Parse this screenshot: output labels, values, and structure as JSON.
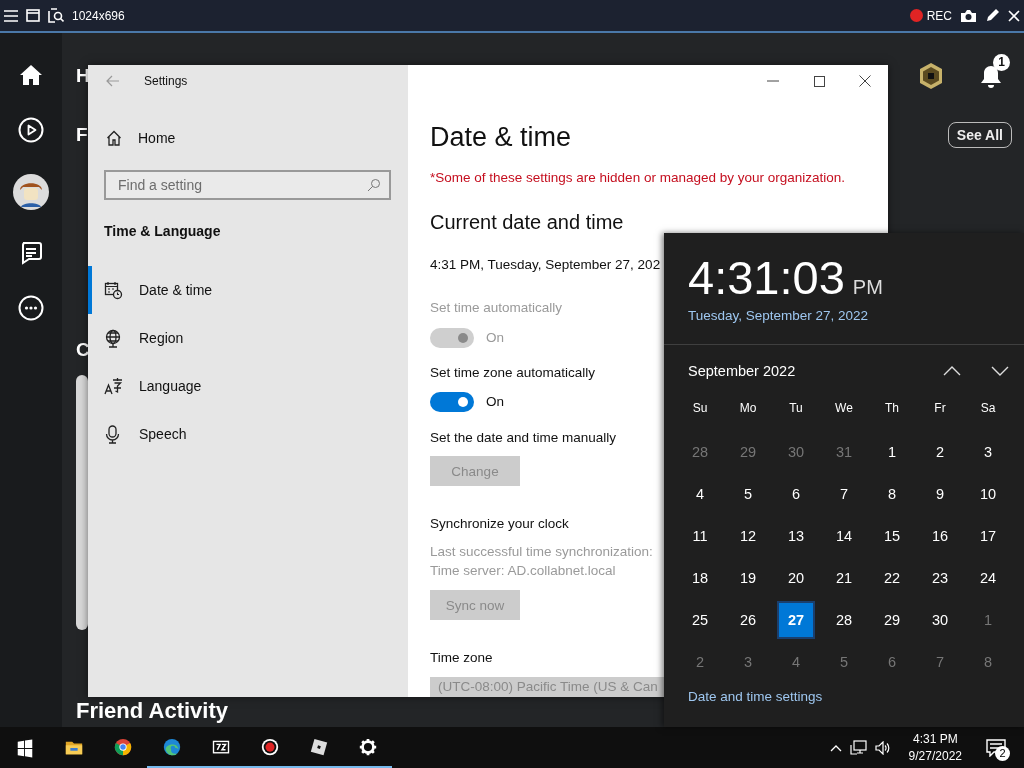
{
  "recorder_bar": {
    "resolution": "1024x696",
    "rec_label": "REC",
    "recording": true
  },
  "app": {
    "rail": [
      {
        "kind": "home"
      },
      {
        "kind": "play"
      },
      {
        "kind": "avatar"
      },
      {
        "kind": "chat"
      },
      {
        "kind": "more"
      }
    ],
    "heading_1": "H",
    "heading_2": "F",
    "heading_3": "C",
    "see_all": "See All",
    "notification_count": "1",
    "friend_activity": "Friend Activity"
  },
  "settings": {
    "title": "Settings",
    "home": "Home",
    "search_placeholder": "Find a setting",
    "section": "Time & Language",
    "nav": [
      {
        "label": "Date & time",
        "kind": "calendar",
        "selected": true
      },
      {
        "label": "Region",
        "kind": "globe",
        "selected": false
      },
      {
        "label": "Language",
        "kind": "language",
        "selected": false
      },
      {
        "label": "Speech",
        "kind": "microphone",
        "selected": false
      }
    ],
    "page_title": "Date & time",
    "notice": "*Some of these settings are hidden or managed by your organization.",
    "current_heading": "Current date and time",
    "current_value": "4:31 PM, Tuesday, September 27, 202",
    "toggles": [
      {
        "label": "Set time automatically",
        "state_label": "On",
        "on": true,
        "disabled": true
      },
      {
        "label": "Set time zone automatically",
        "state_label": "On",
        "on": true,
        "disabled": false
      }
    ],
    "manual_label": "Set the date and time manually",
    "change_button": {
      "label": "Change",
      "disabled": true
    },
    "sync_heading": "Synchronize your clock",
    "sync_lines": [
      "Last successful time synchronization:",
      "Time server: AD.collabnet.local"
    ],
    "sync_button": {
      "label": "Sync now",
      "disabled": true
    },
    "timezone_label": "Time zone",
    "timezone_value": "(UTC-08:00) Pacific Time (US & Can",
    "timezone_disabled": true
  },
  "clock_flyout": {
    "time": "4:31:03",
    "ampm": "PM",
    "date": "Tuesday, September 27, 2022",
    "month": "September 2022",
    "weekdays": [
      "Su",
      "Mo",
      "Tu",
      "We",
      "Th",
      "Fr",
      "Sa"
    ],
    "weeks": [
      [
        {
          "day": "28",
          "in_month": false,
          "selected": false
        },
        {
          "day": "29",
          "in_month": false,
          "selected": false
        },
        {
          "day": "30",
          "in_month": false,
          "selected": false
        },
        {
          "day": "31",
          "in_month": false,
          "selected": false
        },
        {
          "day": "1",
          "in_month": true,
          "selected": false
        },
        {
          "day": "2",
          "in_month": true,
          "selected": false
        },
        {
          "day": "3",
          "in_month": true,
          "selected": false
        }
      ],
      [
        {
          "day": "4",
          "in_month": true,
          "selected": false
        },
        {
          "day": "5",
          "in_month": true,
          "selected": false
        },
        {
          "day": "6",
          "in_month": true,
          "selected": false
        },
        {
          "day": "7",
          "in_month": true,
          "selected": false
        },
        {
          "day": "8",
          "in_month": true,
          "selected": false
        },
        {
          "day": "9",
          "in_month": true,
          "selected": false
        },
        {
          "day": "10",
          "in_month": true,
          "selected": false
        }
      ],
      [
        {
          "day": "11",
          "in_month": true,
          "selected": false
        },
        {
          "day": "12",
          "in_month": true,
          "selected": false
        },
        {
          "day": "13",
          "in_month": true,
          "selected": false
        },
        {
          "day": "14",
          "in_month": true,
          "selected": false
        },
        {
          "day": "15",
          "in_month": true,
          "selected": false
        },
        {
          "day": "16",
          "in_month": true,
          "selected": false
        },
        {
          "day": "17",
          "in_month": true,
          "selected": false
        }
      ],
      [
        {
          "day": "18",
          "in_month": true,
          "selected": false
        },
        {
          "day": "19",
          "in_month": true,
          "selected": false
        },
        {
          "day": "20",
          "in_month": true,
          "selected": false
        },
        {
          "day": "21",
          "in_month": true,
          "selected": false
        },
        {
          "day": "22",
          "in_month": true,
          "selected": false
        },
        {
          "day": "23",
          "in_month": true,
          "selected": false
        },
        {
          "day": "24",
          "in_month": true,
          "selected": false
        }
      ],
      [
        {
          "day": "25",
          "in_month": true,
          "selected": false
        },
        {
          "day": "26",
          "in_month": true,
          "selected": false
        },
        {
          "day": "27",
          "in_month": true,
          "selected": true
        },
        {
          "day": "28",
          "in_month": true,
          "selected": false
        },
        {
          "day": "29",
          "in_month": true,
          "selected": false
        },
        {
          "day": "30",
          "in_month": true,
          "selected": false
        },
        {
          "day": "1",
          "in_month": false,
          "selected": false
        }
      ],
      [
        {
          "day": "2",
          "in_month": false,
          "selected": false
        },
        {
          "day": "3",
          "in_month": false,
          "selected": false
        },
        {
          "day": "4",
          "in_month": false,
          "selected": false
        },
        {
          "day": "5",
          "in_month": false,
          "selected": false
        },
        {
          "day": "6",
          "in_month": false,
          "selected": false
        },
        {
          "day": "7",
          "in_month": false,
          "selected": false
        },
        {
          "day": "8",
          "in_month": false,
          "selected": false
        }
      ]
    ],
    "settings_link": "Date and time settings"
  },
  "taskbar": {
    "apps": [
      {
        "kind": "start",
        "running": false
      },
      {
        "kind": "folder",
        "running": false
      },
      {
        "kind": "chrome",
        "running": false
      },
      {
        "kind": "edge",
        "running": true
      },
      {
        "kind": "archive",
        "running": true
      },
      {
        "kind": "recorder",
        "running": true
      },
      {
        "kind": "roblox",
        "running": true
      },
      {
        "kind": "gear",
        "running": true
      }
    ],
    "time": "4:31 PM",
    "date": "9/27/2022",
    "notification_count": "2"
  }
}
